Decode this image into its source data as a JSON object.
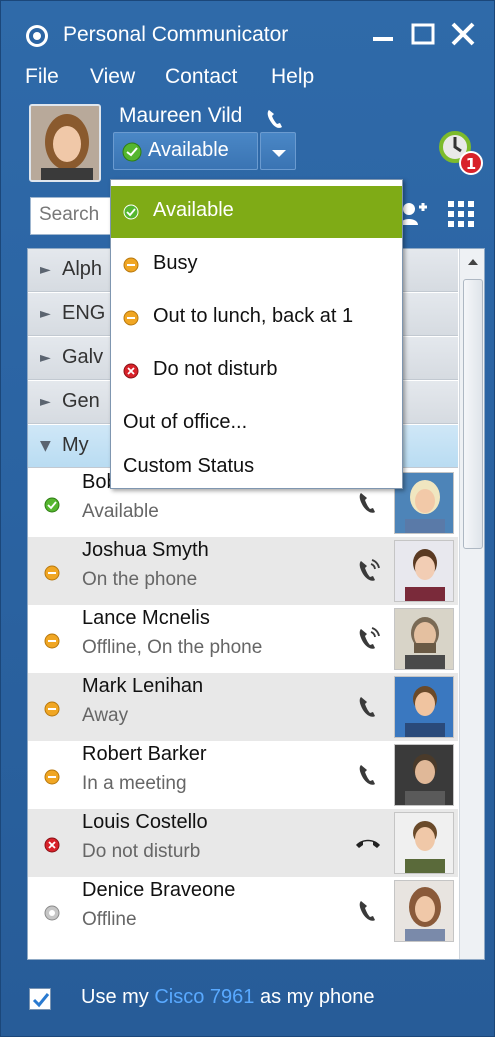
{
  "window": {
    "title": "Personal Communicator"
  },
  "menu": [
    "File",
    "View",
    "Contact",
    "Help"
  ],
  "user": {
    "name": "Maureen Vild",
    "status": "Available"
  },
  "alarm_badge": "1",
  "search": {
    "placeholder": "Search"
  },
  "status_menu": [
    {
      "label": "Available",
      "icon": "available",
      "selected": true
    },
    {
      "label": "Busy",
      "icon": "busy"
    },
    {
      "label": "Out to lunch, back at 1",
      "icon": "busy"
    },
    {
      "label": "Do not disturb",
      "icon": "dnd"
    },
    {
      "label": "Out of office..."
    },
    {
      "label": "Custom Status"
    }
  ],
  "groups": [
    {
      "name": "Alph"
    },
    {
      "name": "ENG"
    },
    {
      "name": "Galv"
    },
    {
      "name": "Gen"
    },
    {
      "name": "My "
    }
  ],
  "contacts": [
    {
      "name": "Bobbie Carrick",
      "status": "Available",
      "presence": "available",
      "phone": "phone"
    },
    {
      "name": "Joshua Smyth",
      "status": "On the phone",
      "presence": "busy",
      "phone": "on-call"
    },
    {
      "name": "Lance Mcnelis",
      "status": "Offline, On the phone",
      "presence": "busy",
      "phone": "on-call"
    },
    {
      "name": "Mark Lenihan",
      "status": "Away",
      "presence": "busy",
      "phone": "phone"
    },
    {
      "name": "Robert Barker",
      "status": "In a meeting",
      "presence": "busy",
      "phone": "phone"
    },
    {
      "name": "Louis Costello",
      "status": "Do not disturb",
      "presence": "dnd",
      "phone": "hangup"
    },
    {
      "name": "Denice Braveone",
      "status": "Offline",
      "presence": "offline",
      "phone": "phone"
    }
  ],
  "footer": {
    "prefix": "Use my ",
    "link": "Cisco 7961",
    "suffix": " as my phone",
    "checked": true
  },
  "colors": {
    "available": "#55b62f",
    "busy": "#f0a623",
    "dnd": "#d8222a",
    "offline": "#a8a8a8",
    "selected_menu": "#7fab16",
    "window_blue": "#2b64a3"
  }
}
